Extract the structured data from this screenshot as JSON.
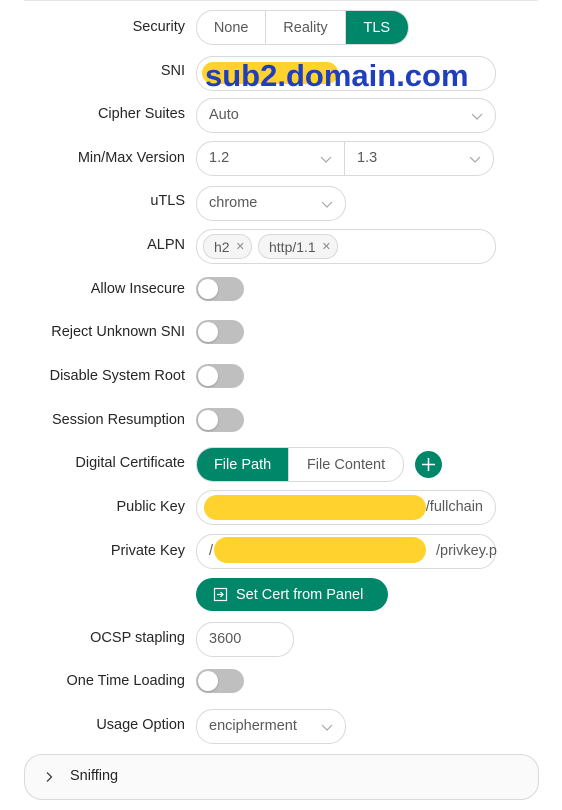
{
  "tls": {
    "security": {
      "label": "Security",
      "options": [
        "None",
        "Reality",
        "TLS"
      ],
      "selected": "TLS"
    },
    "sni": {
      "label": "SNI",
      "value": "sub2.domain.com"
    },
    "cipher_suites": {
      "label": "Cipher Suites",
      "value": "Auto"
    },
    "version": {
      "label": "Min/Max Version",
      "min": "1.2",
      "max": "1.3"
    },
    "utls": {
      "label": "uTLS",
      "value": "chrome"
    },
    "alpn": {
      "label": "ALPN",
      "tags": [
        "h2",
        "http/1.1"
      ]
    },
    "allow_insecure": {
      "label": "Allow Insecure",
      "on": false
    },
    "reject_unknown_sni": {
      "label": "Reject Unknown SNI",
      "on": false
    },
    "disable_system_root": {
      "label": "Disable System Root",
      "on": false
    },
    "session_resumption": {
      "label": "Session Resumption",
      "on": false
    },
    "digital_certificate": {
      "label": "Digital Certificate",
      "options": [
        "File Path",
        "File Content"
      ],
      "selected": "File Path"
    },
    "public_key": {
      "label": "Public Key",
      "visible_value": "/fullchain"
    },
    "private_key": {
      "label": "Private Key",
      "visible_prefix": "/",
      "visible_value": "/privkey.p"
    },
    "set_cert_button": "Set Cert from Panel",
    "ocsp_stapling": {
      "label": "OCSP stapling",
      "value": "3600"
    },
    "one_time_loading": {
      "label": "One Time Loading",
      "on": false
    },
    "usage_option": {
      "label": "Usage Option",
      "value": "encipherment"
    }
  },
  "sniffing": {
    "title": "Sniffing"
  },
  "colors": {
    "accent": "#00876a",
    "redaction": "#ffd22e",
    "sni_overlay_text": "#1f3fbd",
    "toggle_off": "#bfbfbf"
  },
  "icons": [
    "chevron-down-icon",
    "close-icon",
    "plus-icon",
    "import-icon",
    "chevron-right-icon"
  ]
}
